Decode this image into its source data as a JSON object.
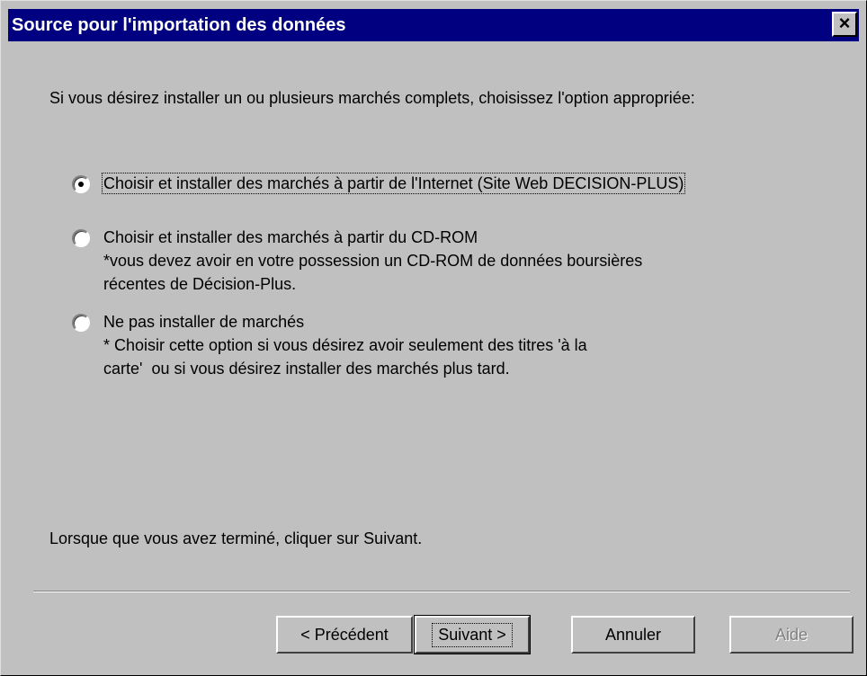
{
  "window": {
    "title": "Source pour l'importation des données",
    "close_glyph": "×"
  },
  "intro_text": "Si vous désirez installer un ou plusieurs marchés complets, choisissez l'option appropriée:",
  "options": [
    {
      "line1": "Choisir et installer des marchés à partir de l'Internet (Site Web DECISION-PLUS)",
      "line2": "",
      "line3": "",
      "checked": true
    },
    {
      "line1": "Choisir et installer des marchés à partir du CD-ROM",
      "line2": "*vous devez avoir en votre possession un CD-ROM de données boursières",
      "line3": "récentes de Décision-Plus.",
      "checked": false
    },
    {
      "line1": "Ne pas installer de marchés",
      "line2": "* Choisir cette option si vous désirez avoir seulement des titres 'à la",
      "line3": "carte'  ou si vous désirez installer des marchés plus tard.",
      "checked": false
    }
  ],
  "footer_text": "Lorsque que vous avez terminé, cliquer sur Suivant.",
  "buttons": {
    "previous": "< Précédent",
    "next": "Suivant >",
    "cancel": "Annuler",
    "help": "Aide"
  },
  "colors": {
    "titlebar": "#000080",
    "face": "#c0c0c0"
  }
}
